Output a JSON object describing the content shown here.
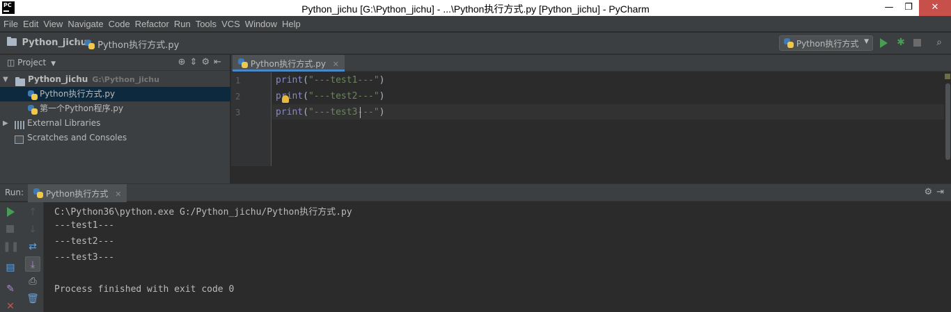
{
  "window": {
    "title": "Python_jichu [G:\\Python_jichu] - ...\\Python执行方式.py [Python_jichu] - PyCharm",
    "app_icon_text": "PC",
    "minimize": "—",
    "maximize": "❐",
    "close": "✕"
  },
  "menu": [
    "File",
    "Edit",
    "View",
    "Navigate",
    "Code",
    "Refactor",
    "Run",
    "Tools",
    "VCS",
    "Window",
    "Help"
  ],
  "navbar": {
    "project": "Python_jichu",
    "file": "Python执行方式.py",
    "run_config": "Python执行方式"
  },
  "project_panel": {
    "title": "Project",
    "tree": [
      {
        "label": "Python_jichu",
        "path": "G:\\Python_jichu"
      },
      {
        "label": "Python执行方式.py"
      },
      {
        "label": "第一个Python程序.py"
      },
      {
        "label": "External Libraries"
      },
      {
        "label": "Scratches and Consoles"
      }
    ]
  },
  "editor": {
    "tab": "Python执行方式.py",
    "lines": [
      {
        "num": "1",
        "kw": "print",
        "open": "(",
        "str": "\"---test1---\"",
        "close": ")"
      },
      {
        "num": "2",
        "kw": "print",
        "open": "(",
        "str": "\"---test2---\"",
        "close": ")"
      },
      {
        "num": "3",
        "kw": "print",
        "open": "(",
        "str": "\"---test3---\"",
        "close": ")"
      }
    ]
  },
  "run_panel": {
    "label": "Run:",
    "tab": "Python执行方式",
    "console": [
      "C:\\Python36\\python.exe G:/Python_jichu/Python执行方式.py",
      "---test1---",
      "---test2---",
      "---test3---",
      "",
      "Process finished with exit code 0"
    ]
  },
  "colors": {
    "keyword": "#8888c6",
    "string": "#6a8759",
    "run_green": "#499c54",
    "stop_red": "#c75450",
    "selection": "#0d293e"
  }
}
